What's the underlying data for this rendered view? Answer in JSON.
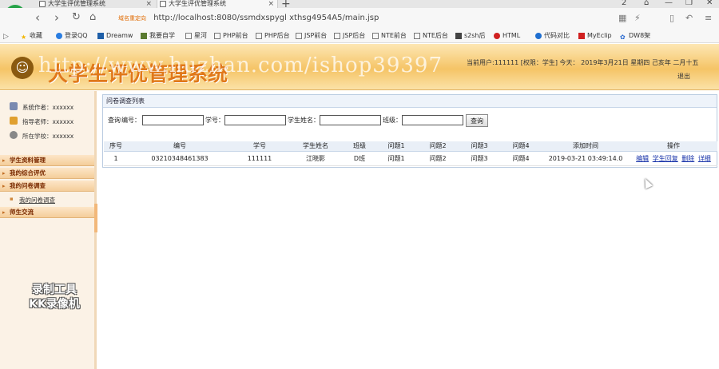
{
  "browser": {
    "tabs": [
      {
        "title": "大学生评优管理系统",
        "active": false
      },
      {
        "title": "大学生评优管理系统",
        "active": true
      }
    ],
    "new_tab_icon": "+",
    "address_hint": "域名重定向",
    "url": "http://localhost:8080/ssmdxspygl xthsg4954A5/main.jsp",
    "bookmarks": [
      {
        "label": "收藏",
        "icon": "star-icon"
      },
      {
        "label": "登录QQ",
        "icon": "globe-icon"
      },
      {
        "label": "Dreamw",
        "icon": "d-icon"
      },
      {
        "label": "我要自学",
        "icon": "book-icon"
      },
      {
        "label": "星河",
        "icon": "page-icon"
      },
      {
        "label": "PHP前台",
        "icon": "page-icon"
      },
      {
        "label": "PHP后台",
        "icon": "page-icon"
      },
      {
        "label": "JSP前台",
        "icon": "page-icon"
      },
      {
        "label": "JSP后台",
        "icon": "page-icon"
      },
      {
        "label": "NTE前台",
        "icon": "page-icon"
      },
      {
        "label": "NTE后台",
        "icon": "page-icon"
      },
      {
        "label": "s2sh后",
        "icon": "page-icon"
      },
      {
        "label": "HTML",
        "icon": "html-icon"
      },
      {
        "label": "代码对比",
        "icon": "c-icon"
      },
      {
        "label": "MyEclip",
        "icon": "c-icon"
      },
      {
        "label": "DW8架",
        "icon": "dw-icon"
      }
    ],
    "tab_counter": "2"
  },
  "header": {
    "title": "大学生评优管理系统",
    "watermark": "http://www.huzhan.com/ishop39397",
    "user_info": "当前用户:111111 [权限：学生]  今天： 2019年3月21日 星期四 己亥年 二月十五",
    "logout": "退出"
  },
  "sidebar": {
    "info": [
      {
        "label": "系统作者：xxxxxx",
        "color": "#7a8ab0"
      },
      {
        "label": "指导老师：xxxxxx",
        "color": "#e0a030"
      },
      {
        "label": "所在学校：xxxxxx",
        "color": "#888888"
      }
    ],
    "menu": [
      {
        "label": "学生资料管理"
      },
      {
        "label": "我的综合评优"
      },
      {
        "label": "我的问卷调查"
      },
      {
        "label": "师生交流"
      }
    ],
    "sub_items": [
      {
        "label": "我的问卷调查"
      }
    ]
  },
  "panel": {
    "title": "问卷调查列表",
    "search": {
      "lead": "查询",
      "field1_label": "编号：",
      "field2_label": "学号：",
      "field3_label": "学生姓名：",
      "field4_label": "班级：",
      "field1_value": "",
      "field2_value": "",
      "field3_value": "",
      "field4_value": "",
      "button": "查询"
    },
    "table": {
      "headers": [
        "序号",
        "编号",
        "学号",
        "学生姓名",
        "班级",
        "问题1",
        "问题2",
        "问题3",
        "问题4",
        "添加时间",
        "操作"
      ],
      "rows": [
        {
          "cells": [
            "1",
            "03210348461383",
            "111111",
            "江晓影",
            "D班",
            "问题1",
            "问题2",
            "问题3",
            "问题4",
            "2019-03-21 03:49:14.0"
          ],
          "actions": [
            "编辑",
            "学生回复",
            "删除",
            "详细"
          ]
        }
      ]
    }
  },
  "recording_badge": {
    "line1": "录制工具",
    "line2": "KK录像机"
  }
}
